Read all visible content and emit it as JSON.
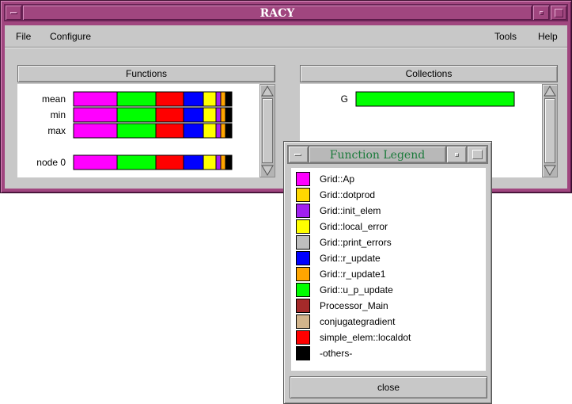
{
  "main_window": {
    "title": "RACY",
    "menu": {
      "file": "File",
      "configure": "Configure",
      "tools": "Tools",
      "help": "Help"
    }
  },
  "functions_panel": {
    "header": "Functions",
    "rows": [
      {
        "label": "mean"
      },
      {
        "label": "min"
      },
      {
        "label": "max"
      },
      {
        "label": "node  0"
      }
    ]
  },
  "collections_panel": {
    "header": "Collections",
    "rows": [
      {
        "label": "G"
      }
    ]
  },
  "legend_window": {
    "title": "Function Legend",
    "close_label": "close",
    "items": [
      {
        "name": "Grid::Ap",
        "color": "#ff00ff"
      },
      {
        "name": "Grid::dotprod",
        "color": "#ffd700"
      },
      {
        "name": "Grid::init_elem",
        "color": "#a020f0"
      },
      {
        "name": "Grid::local_error",
        "color": "#ffff00"
      },
      {
        "name": "Grid::print_errors",
        "color": "#bebebe"
      },
      {
        "name": "Grid::r_update",
        "color": "#0000ff"
      },
      {
        "name": "Grid::r_update1",
        "color": "#ffa500"
      },
      {
        "name": "Grid::u_p_update",
        "color": "#00ff00"
      },
      {
        "name": "Processor_Main",
        "color": "#a52a2a"
      },
      {
        "name": "conjugategradient",
        "color": "#d2b48c"
      },
      {
        "name": "simple_elem::localdot",
        "color": "#ff0000"
      },
      {
        "name": "-others-",
        "color": "#000000"
      }
    ]
  },
  "colors": {
    "frame": "#a0467f",
    "panel_bg": "#c8c8c8",
    "legend_title_text": "#1a7a3a"
  },
  "chart_data": [
    {
      "type": "bar",
      "orientation": "horizontal-stacked",
      "categories": [
        "mean",
        "min",
        "max",
        "node  0"
      ],
      "series": [
        {
          "name": "Grid::Ap",
          "color": "#ff00ff",
          "values": [
            27.5,
            27.5,
            27.5,
            27.5
          ]
        },
        {
          "name": "Grid::u_p_update",
          "color": "#00ff00",
          "values": [
            24.5,
            24.5,
            24.5,
            24.5
          ]
        },
        {
          "name": "simple_elem::localdot",
          "color": "#ff0000",
          "values": [
            17.5,
            17.5,
            17.5,
            17.5
          ]
        },
        {
          "name": "Grid::r_update",
          "color": "#0000ff",
          "values": [
            12.5,
            12.5,
            12.5,
            12.5
          ]
        },
        {
          "name": "Grid::local_error",
          "color": "#ffff00",
          "values": [
            8,
            8,
            8,
            8
          ]
        },
        {
          "name": "Grid::init_elem",
          "color": "#a020f0",
          "values": [
            3,
            3,
            3,
            3
          ]
        },
        {
          "name": "Grid::r_update1",
          "color": "#ffa500",
          "values": [
            3,
            3,
            3,
            3
          ]
        },
        {
          "name": "-others-",
          "color": "#000000",
          "values": [
            4,
            4,
            4,
            4
          ]
        }
      ]
    },
    {
      "type": "bar",
      "orientation": "horizontal-stacked",
      "categories": [
        "G"
      ],
      "series": [
        {
          "name": "Grid::u_p_update",
          "color": "#00ff00",
          "values": [
            100
          ]
        }
      ]
    }
  ]
}
